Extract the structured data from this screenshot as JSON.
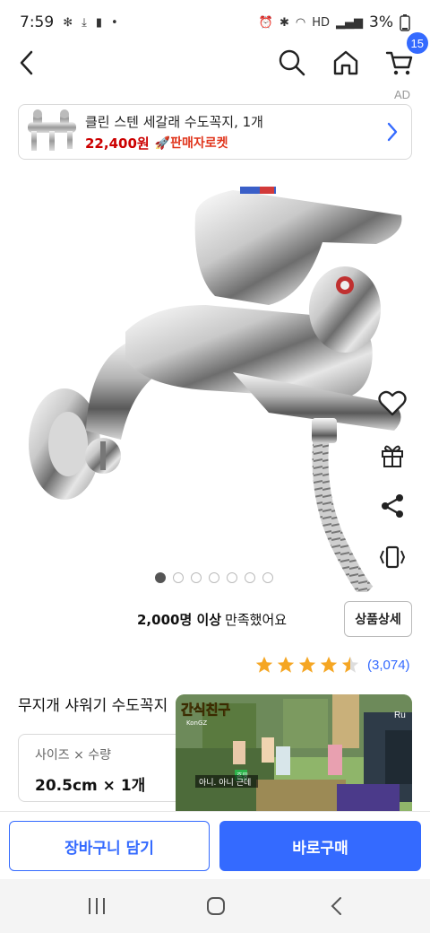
{
  "status_bar": {
    "time": "7:59",
    "battery": "3%",
    "left_icons": [
      "fan-icon",
      "download-icon",
      "battery-alert-icon",
      "dot-icon"
    ],
    "right_icons": [
      "alarm-icon",
      "bluetooth-icon",
      "wifi-icon",
      "hd-icon",
      "signal-icon",
      "battery-icon"
    ]
  },
  "nav": {
    "cart_count": "15",
    "icons": [
      "back-arrow-icon",
      "search-icon",
      "home-icon",
      "cart-icon"
    ]
  },
  "ad": {
    "label": "AD",
    "title": "클린 스텐 세갈래 수도꼭지, 1개",
    "price": "22,400원",
    "rocket_label": "🚀판매자로켓"
  },
  "gallery": {
    "total_images": 7,
    "active_index": 0
  },
  "side_actions": [
    "heart-icon",
    "gift-icon",
    "share-icon",
    "vibrate-icon"
  ],
  "social_proof": {
    "count": "2,000명 이상",
    "suffix": "만족했어요",
    "detail_button": "상품상세"
  },
  "rating": {
    "stars": 4.5,
    "count": "(3,074)",
    "color": "#f5a623"
  },
  "product": {
    "title": "무지개 샤워기 수도꼭지"
  },
  "option": {
    "label": "사이즈 × 수량",
    "value": "20.5cm × 1개"
  },
  "video_overlay": {
    "title": "간식친구",
    "channel": "KonGZ",
    "subtitle": "아니. 아니 근데",
    "speaker_tag": "혼띵",
    "corner_tag": "Ru"
  },
  "bottom_bar": {
    "add_to_cart": "장바구니 담기",
    "buy_now": "바로구매"
  },
  "colors": {
    "accent": "#346aff",
    "price": "#cc0000",
    "rocket": "#e0341b"
  }
}
